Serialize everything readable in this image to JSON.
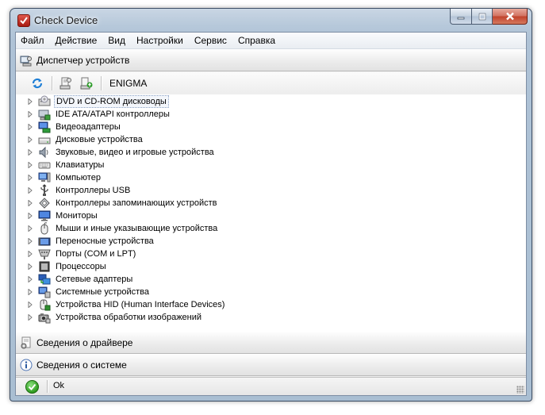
{
  "window": {
    "title": "Check Device"
  },
  "menu": {
    "items": [
      "Файл",
      "Действие",
      "Вид",
      "Настройки",
      "Сервис",
      "Справка"
    ]
  },
  "sections": {
    "device_manager": "Диспетчер устройств",
    "driver_info": "Сведения о драйвере",
    "system_info": "Сведения о системе"
  },
  "toolbar": {
    "computer_name": "ENIGMA"
  },
  "tree": {
    "items": [
      {
        "label": "DVD и CD-ROM дисководы",
        "icon": "dvd-drive-icon"
      },
      {
        "label": "IDE ATA/ATAPI контроллеры",
        "icon": "ide-controller-icon"
      },
      {
        "label": "Видеоадаптеры",
        "icon": "display-adapter-icon"
      },
      {
        "label": "Дисковые устройства",
        "icon": "disk-drive-icon"
      },
      {
        "label": "Звуковые, видео и игровые устройства",
        "icon": "speaker-icon"
      },
      {
        "label": "Клавиатуры",
        "icon": "keyboard-icon"
      },
      {
        "label": "Компьютер",
        "icon": "computer-icon"
      },
      {
        "label": "Контроллеры USB",
        "icon": "usb-icon"
      },
      {
        "label": "Контроллеры запоминающих устройств",
        "icon": "storage-controller-icon"
      },
      {
        "label": "Мониторы",
        "icon": "monitor-icon"
      },
      {
        "label": "Мыши и иные указывающие устройства",
        "icon": "mouse-icon"
      },
      {
        "label": "Переносные устройства",
        "icon": "portable-device-icon"
      },
      {
        "label": "Порты (COM и LPT)",
        "icon": "port-icon"
      },
      {
        "label": "Процессоры",
        "icon": "processor-icon"
      },
      {
        "label": "Сетевые адаптеры",
        "icon": "network-adapter-icon"
      },
      {
        "label": "Системные устройства",
        "icon": "system-device-icon"
      },
      {
        "label": "Устройства HID (Human Interface Devices)",
        "icon": "hid-device-icon"
      },
      {
        "label": "Устройства обработки изображений",
        "icon": "imaging-device-icon"
      }
    ],
    "selected_index": 0
  },
  "status": {
    "text": "Ok"
  }
}
